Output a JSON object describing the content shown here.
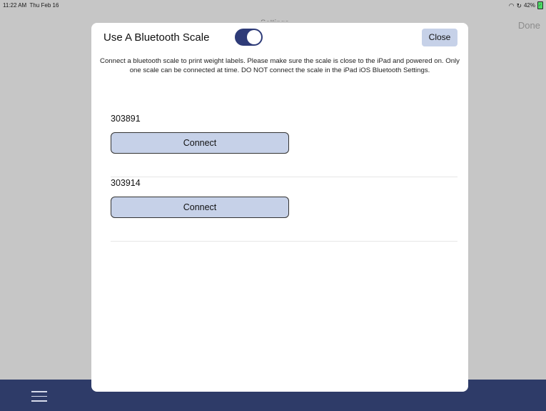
{
  "status_bar": {
    "time": "11:22 AM",
    "date": "Thu Feb 16",
    "battery": "42%"
  },
  "background": {
    "title": "Settings",
    "done_label": "Done"
  },
  "modal": {
    "title": "Use A Bluetooth Scale",
    "toggle_on": true,
    "close_label": "Close",
    "description": "Connect a bluetooth scale to print weight labels. Please make sure the scale is close to the iPad and powered on. Only one scale can be connected at time. DO NOT connect the scale in the iPad iOS Bluetooth Settings.",
    "scales": [
      {
        "id": "303891",
        "button_label": "Connect"
      },
      {
        "id": "303914",
        "button_label": "Connect"
      }
    ]
  },
  "icons": {
    "wifi": "wifi-icon",
    "rotation_lock": "rotation-lock-icon",
    "battery": "battery-charging-icon",
    "menu": "hamburger-menu-icon"
  },
  "colors": {
    "accent": "#2e3b78",
    "button_fill": "#c6d1e8",
    "bottom_bar": "#2e3b68",
    "battery": "#4cd964"
  }
}
